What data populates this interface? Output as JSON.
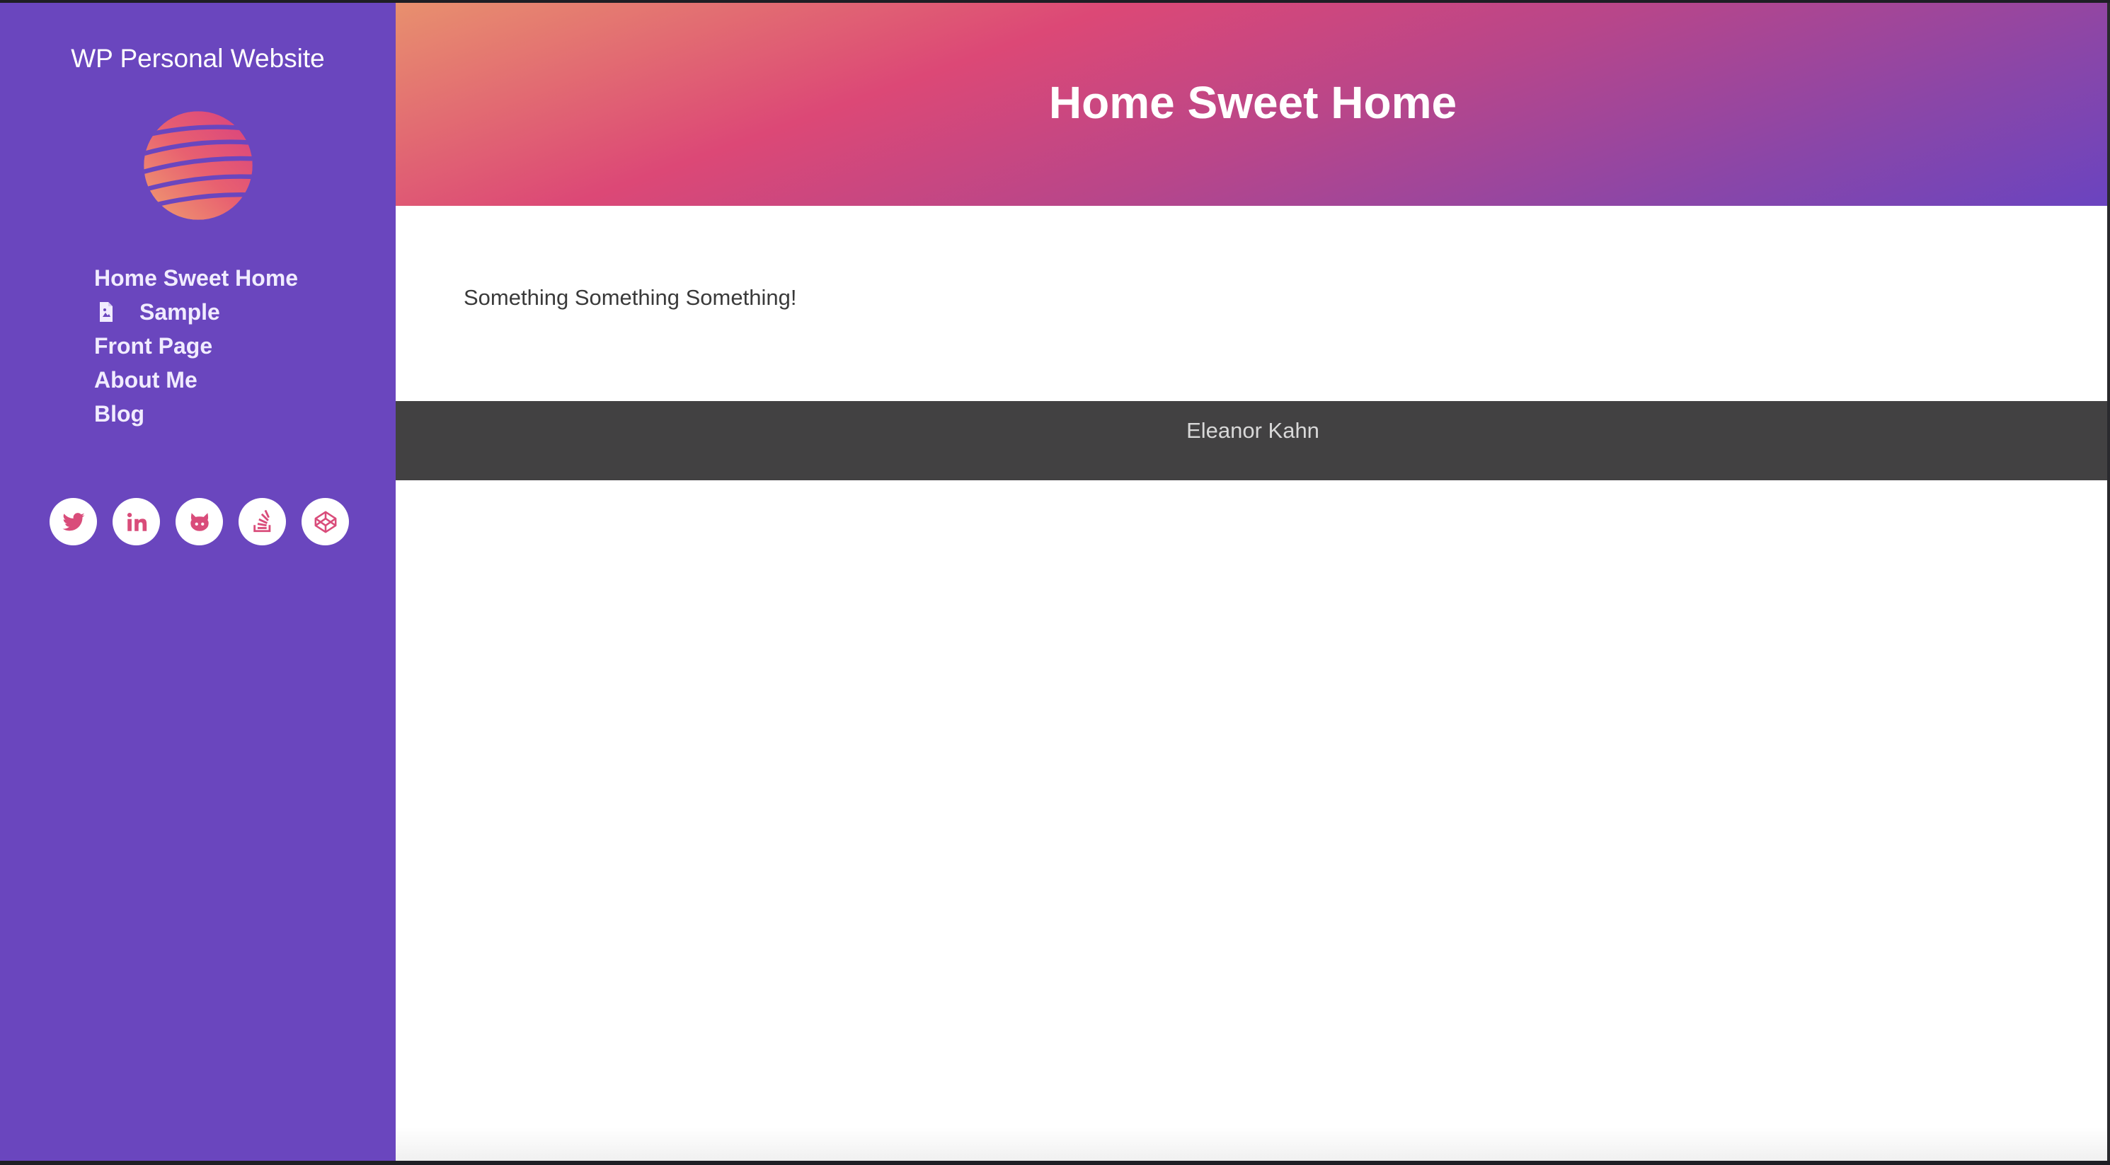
{
  "sidebar": {
    "site_title": "WP Personal Website",
    "logo_icon": "striped-globe-logo",
    "nav_items": [
      {
        "label": "Home Sweet Home"
      },
      {
        "label": "Sample",
        "icon": "page-icon"
      },
      {
        "label": "Front Page"
      },
      {
        "label": "About Me"
      },
      {
        "label": "Blog"
      }
    ],
    "social_links": [
      {
        "icon": "twitter-icon"
      },
      {
        "icon": "linkedin-icon"
      },
      {
        "icon": "github-icon"
      },
      {
        "icon": "stackoverflow-icon"
      },
      {
        "icon": "codepen-icon"
      }
    ]
  },
  "main": {
    "page_title": "Home Sweet Home",
    "body_text": "Something Something Something!",
    "footer_text": "Eleanor Kahn"
  },
  "colors": {
    "sidebar_bg": "#6a46be",
    "accent_pink": "#dc4876",
    "footer_bg": "#424142"
  }
}
